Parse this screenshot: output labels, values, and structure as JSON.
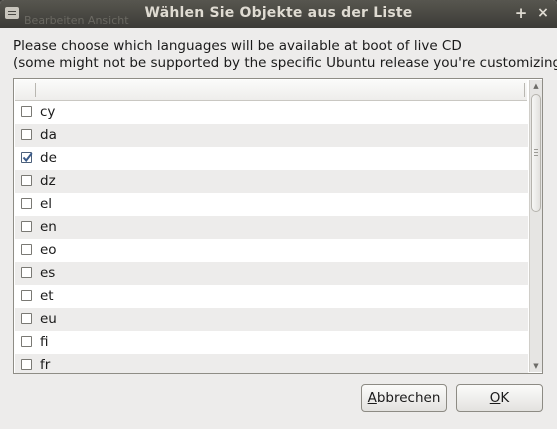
{
  "window": {
    "title": "Wählen Sie Objekte aus der Liste",
    "ghost_text": "Bearbeiten   Ansicht",
    "maximize_glyph": "+",
    "close_glyph": "×"
  },
  "prompt": {
    "line1": "Please choose which languages will be available at boot of live CD",
    "line2": "(some might not be supported by the specific Ubuntu release you're customizing)"
  },
  "list": {
    "items": [
      {
        "label": "cy",
        "checked": false
      },
      {
        "label": "da",
        "checked": false
      },
      {
        "label": "de",
        "checked": true
      },
      {
        "label": "dz",
        "checked": false
      },
      {
        "label": "el",
        "checked": false
      },
      {
        "label": "en",
        "checked": false
      },
      {
        "label": "eo",
        "checked": false
      },
      {
        "label": "es",
        "checked": false
      },
      {
        "label": "et",
        "checked": false
      },
      {
        "label": "eu",
        "checked": false
      },
      {
        "label": "fi",
        "checked": false
      },
      {
        "label": "fr",
        "checked": false
      }
    ]
  },
  "buttons": {
    "cancel_mnemonic": "A",
    "cancel_rest": "bbrechen",
    "ok_mnemonic": "O",
    "ok_rest": "K"
  },
  "icons": {
    "window_menu": "window-menu-icon",
    "maximize": "plus-icon",
    "close": "close-icon",
    "check": "checkmark-icon",
    "scroll_up": "arrow-up-icon",
    "scroll_down": "arrow-down-icon"
  },
  "colors": {
    "titlebar": "#3c3b37",
    "window_bg": "#edeceb",
    "check_accent": "#3b5b8a"
  }
}
